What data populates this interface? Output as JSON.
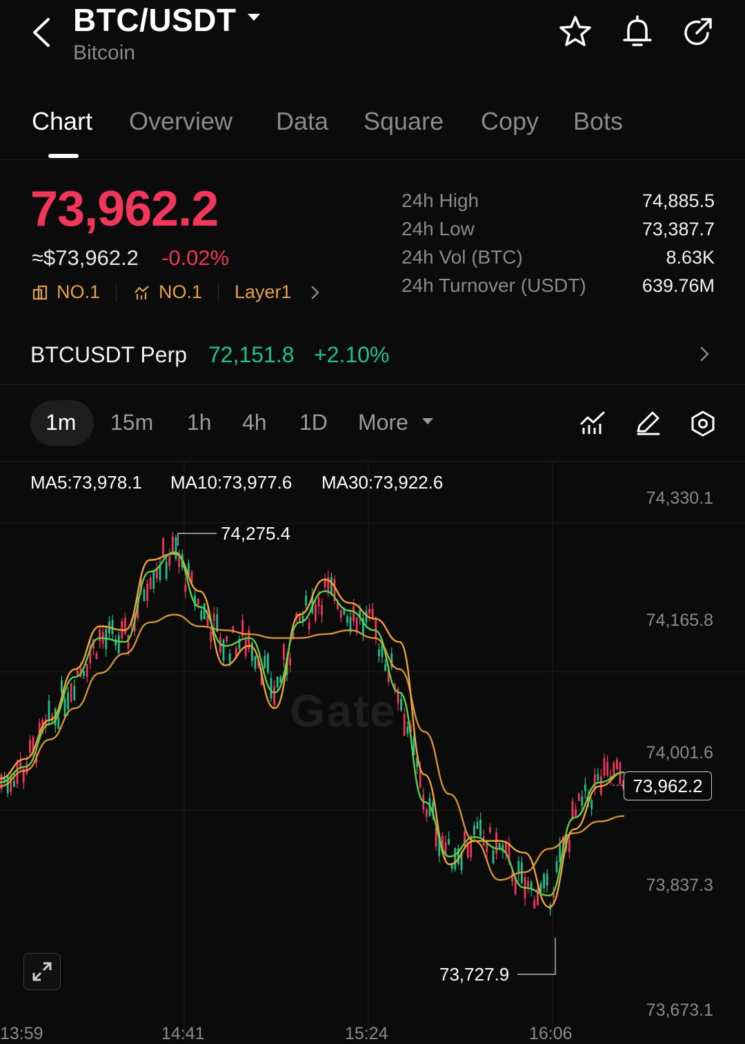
{
  "header": {
    "pair": "BTC/USDT",
    "name": "Bitcoin",
    "icons": [
      "back-icon",
      "caret-down-icon",
      "star-icon",
      "bell-icon",
      "share-icon"
    ]
  },
  "tabs": [
    {
      "label": "Chart",
      "active": true
    },
    {
      "label": "Overview"
    },
    {
      "label": "Data"
    },
    {
      "label": "Square"
    },
    {
      "label": "Copy"
    },
    {
      "label": "Bots"
    }
  ],
  "price": {
    "last": "73,962.2",
    "usd": "≈$73,962.2",
    "change": "-0.02%",
    "ranks": [
      {
        "icon": "ticker-icon",
        "label": "NO.1"
      },
      {
        "icon": "hot-chart-icon",
        "label": "NO.1"
      }
    ],
    "category": "Layer1"
  },
  "stats": [
    {
      "label": "24h  High",
      "value": "74,885.5"
    },
    {
      "label": "24h  Low",
      "value": "73,387.7"
    },
    {
      "label": "24h  Vol (BTC)",
      "value": "8.63K"
    },
    {
      "label": "24h  Turnover (USDT)",
      "value": "639.76M"
    }
  ],
  "perp": {
    "name": "BTCUSDT Perp",
    "price": "72,151.8",
    "change": "+2.10%"
  },
  "intervals": {
    "items": [
      "1m",
      "15m",
      "1h",
      "4h",
      "1D"
    ],
    "active": "1m",
    "more": "More"
  },
  "toolbar_icons": [
    "indicator-icon",
    "draw-icon",
    "settings-icon"
  ],
  "ma": {
    "ma5": "MA5:73,978.1",
    "ma10": "MA10:73,977.6",
    "ma30": "MA30:73,922.6",
    "colors": {
      "ma5": "#f0a33a",
      "ma10": "#5fd14a",
      "ma30": "#f0a33a"
    }
  },
  "chart_data": {
    "type": "line",
    "y_ticks": [
      "74,330.1",
      "74,165.8",
      "74,001.6",
      "73,837.3",
      "73,673.1"
    ],
    "x_ticks": [
      "13:59",
      "14:41",
      "15:24",
      "16:06"
    ],
    "high_label": "74,275.4",
    "low_label": "73,727.9",
    "current_label": "73,962.2",
    "ylim": [
      73673.1,
      74330.1
    ],
    "series": [
      {
        "name": "MA5",
        "values": [
          73970,
          73995,
          74045,
          74110,
          74165,
          74160,
          74250,
          74258,
          74210,
          74115,
          74140,
          74060,
          74180,
          74225,
          74195,
          74175,
          74145,
          73975,
          73860,
          73890,
          73890,
          73875,
          73805,
          73905,
          73960,
          73978
        ]
      },
      {
        "name": "MA10",
        "values": [
          73965,
          73985,
          74040,
          74100,
          74150,
          74145,
          74235,
          74260,
          74190,
          74140,
          74150,
          74080,
          74170,
          74210,
          74185,
          74160,
          74080,
          73940,
          73870,
          73895,
          73880,
          73830,
          73820,
          73920,
          73965,
          73978
        ]
      },
      {
        "name": "MA30",
        "values": [
          73960,
          73980,
          74020,
          74060,
          74105,
          74130,
          74170,
          74180,
          74165,
          74160,
          74155,
          74150,
          74150,
          74155,
          74160,
          74150,
          74110,
          74030,
          73950,
          73890,
          73840,
          73850,
          73880,
          73900,
          73915,
          73922
        ]
      }
    ]
  }
}
